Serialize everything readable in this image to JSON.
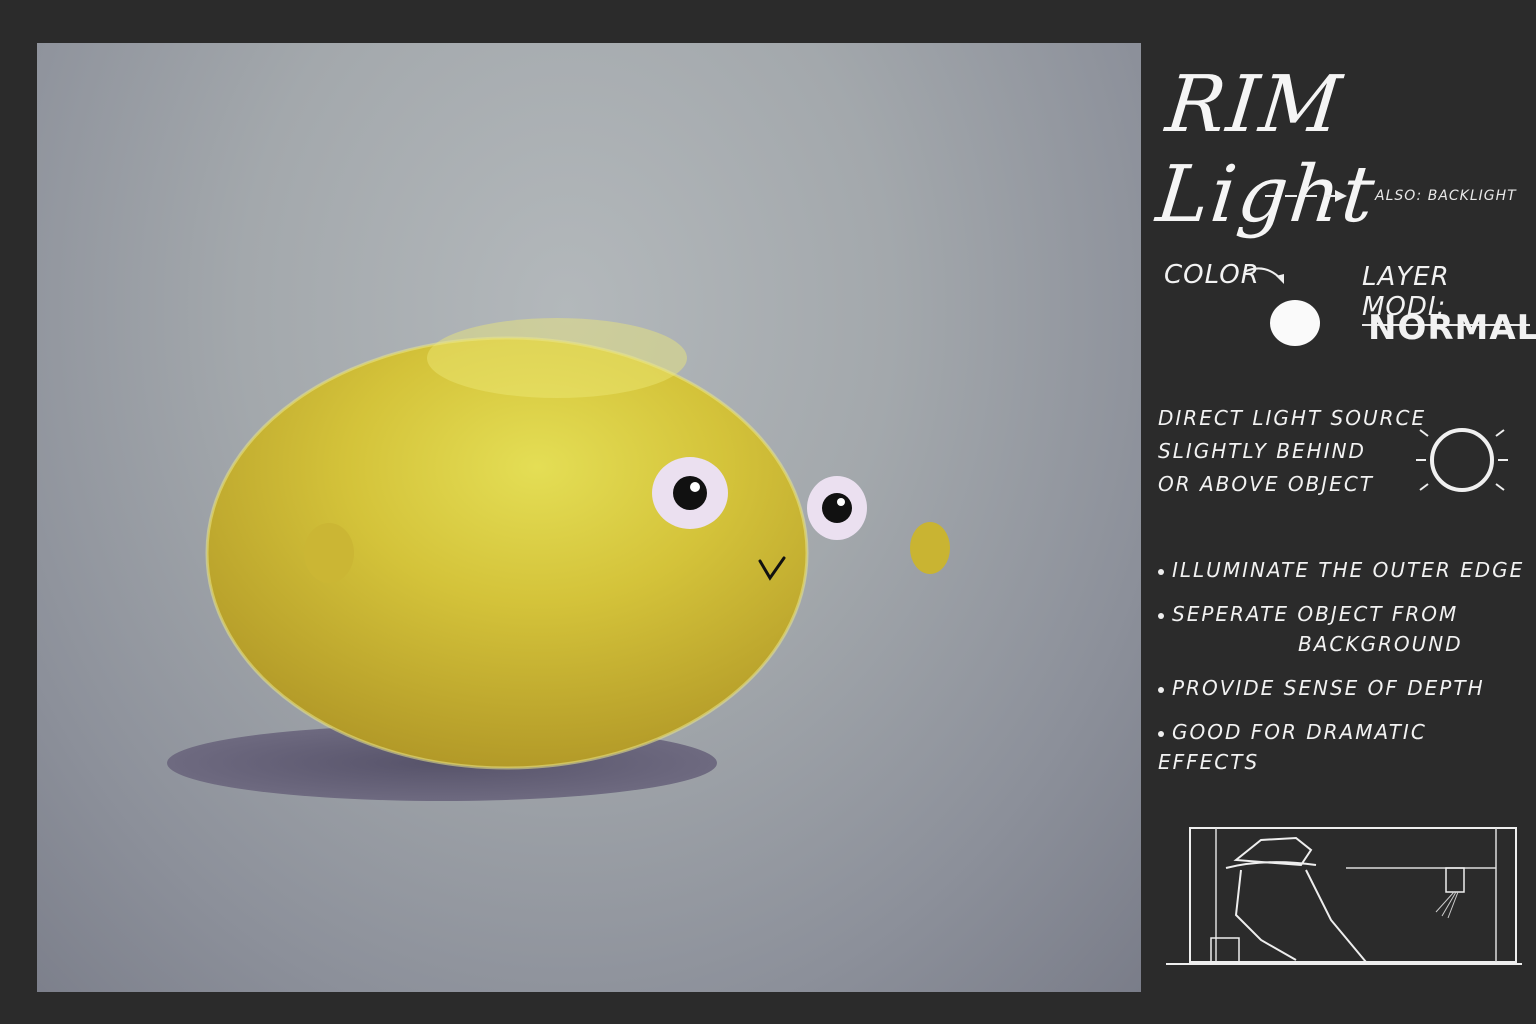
{
  "title": "RIM Light",
  "subtitle": "ALSO: BACKLIGHT",
  "color_label": "COLOR",
  "color_swatch": "#fafafa",
  "layer_mode_label": "LAYER MODI:",
  "layer_mode_value": "NORMAL",
  "direct_light": [
    "DIRECT LIGHT SOURCE",
    "SLIGHTLY BEHIND",
    "OR ABOVE OBJECT"
  ],
  "bullets": [
    {
      "text": "ILLUMINATE THE OUTER EDGE"
    },
    {
      "text": "SEPERATE OBJECT FROM",
      "continuation": "BACKGROUND"
    },
    {
      "text": "PROVIDE SENSE OF DEPTH"
    },
    {
      "text": "GOOD FOR DRAMATIC EFFECTS"
    }
  ],
  "colors": {
    "background": "#2b2b2b",
    "lemon": "#d6c63a",
    "lemon_highlight": "#e3dc55",
    "shadow": "#5f5b70",
    "eye_white": "#ece2f0"
  }
}
